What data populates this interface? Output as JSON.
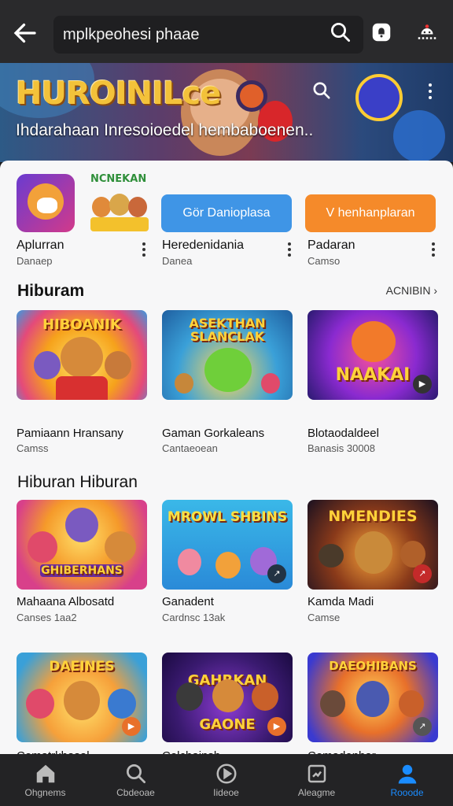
{
  "search": {
    "query": "mplkpeohesi phaae"
  },
  "banner": {
    "title": "HUROINILce",
    "subtitle": "Ihdarahaan Inresoioedel hembaboenen.."
  },
  "top_apps": [
    {
      "title": "Aplurran",
      "subtitle": "Danaep"
    },
    {
      "title": "Heredenidania",
      "subtitle": "Danea",
      "button": "Gör Danioplasa",
      "logo_text": "NCNEKAN"
    },
    {
      "title": "Padaran",
      "subtitle": "Camso",
      "button": "V henhanplaran"
    }
  ],
  "section1": {
    "title": "Hiburam",
    "see_all": "ACNIBIN",
    "cards": [
      {
        "art_text": "HIBOANIK",
        "title": "Pamiaann Hransany",
        "subtitle": "Camss"
      },
      {
        "art_text": "ASEKTHAN SLANCLAK",
        "title": "Gaman Gorkaleans",
        "subtitle": "Cantaeoean"
      },
      {
        "art_text": "NAAKAI",
        "title": "Blotaodaldeel",
        "subtitle": "Banasis 30008"
      }
    ]
  },
  "section2": {
    "title": "Hiburan Hiburan",
    "cards": [
      {
        "art_text": "GHIBERHANS",
        "title": "Mahaana Albosatd",
        "subtitle": "Canses 1aa2"
      },
      {
        "art_text": "MROWL SHBINS",
        "title": "Ganadent",
        "subtitle": "Cardnsc 13ak"
      },
      {
        "art_text": "NMENDIES",
        "title": "Kamda Madi",
        "subtitle": "Camse"
      }
    ]
  },
  "section3": {
    "cards": [
      {
        "art_text": "DAEINES",
        "title": "Comatrkhasal"
      },
      {
        "art_text": "GAHRKAN GAONE",
        "title": "Colchainsh"
      },
      {
        "art_text": "DAEOHIBANS",
        "title": "Comadenhar"
      }
    ]
  },
  "nav": [
    {
      "label": "Ohgnems",
      "icon": "home-icon"
    },
    {
      "label": "Cbdeoae",
      "icon": "search-icon"
    },
    {
      "label": "Iideoe",
      "icon": "video-icon"
    },
    {
      "label": "Aleagme",
      "icon": "library-icon"
    },
    {
      "label": "Rooode",
      "icon": "profile-icon",
      "active": true
    }
  ],
  "colors": {
    "accent_blue": "#1a8cff",
    "pill_blue": "#3f95e6",
    "pill_orange": "#f58a2a"
  }
}
